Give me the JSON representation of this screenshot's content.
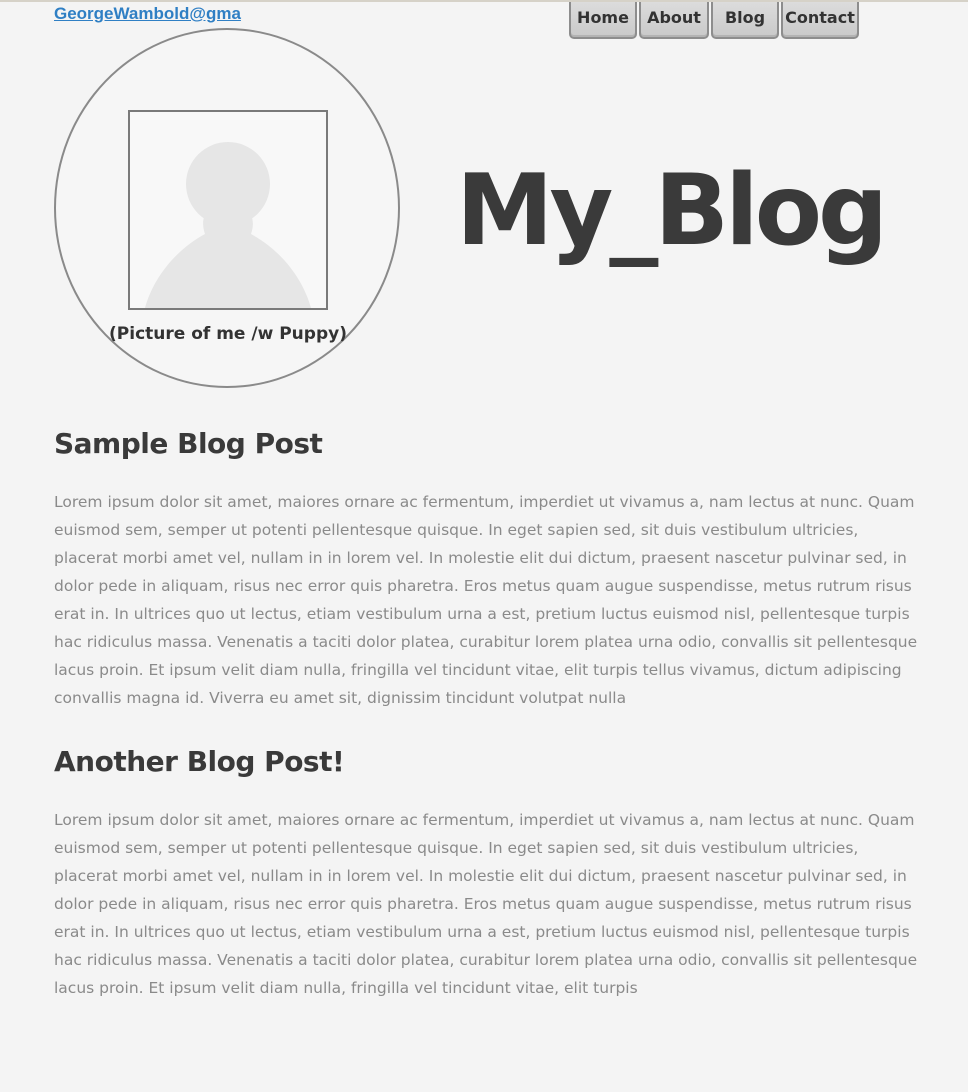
{
  "header": {
    "email": "GeorgeWambold@gma",
    "nav": [
      {
        "label": "Home"
      },
      {
        "label": "About"
      },
      {
        "label": "Blog"
      },
      {
        "label": "Contact"
      }
    ]
  },
  "profile": {
    "caption": "(Picture of me /w Puppy)"
  },
  "site_title": "My_Blog",
  "posts": [
    {
      "title": "Sample Blog Post",
      "body": "Lorem ipsum dolor sit amet, maiores ornare ac fermentum, imperdiet ut vivamus a, nam lectus at nunc. Quam euismod sem, semper ut potenti pellentesque quisque. In eget sapien sed, sit duis vestibulum ultricies, placerat morbi amet vel, nullam in in lorem vel. In molestie elit dui dictum, praesent nascetur pulvinar sed, in dolor pede in aliquam, risus nec error quis pharetra. Eros metus quam augue suspendisse, metus rutrum risus erat in.  In ultrices quo ut lectus, etiam vestibulum urna a est, pretium luctus euismod nisl, pellentesque turpis hac ridiculus massa. Venenatis a taciti dolor platea, curabitur lorem platea urna odio, convallis sit pellentesque lacus proin. Et ipsum velit diam nulla, fringilla vel tincidunt vitae, elit turpis tellus vivamus, dictum adipiscing convallis magna id. Viverra eu amet sit, dignissim tincidunt volutpat nulla"
    },
    {
      "title": "Another Blog Post!",
      "body": "Lorem ipsum dolor sit amet, maiores ornare ac fermentum, imperdiet ut vivamus a, nam lectus at nunc. Quam euismod sem, semper ut potenti pellentesque quisque. In eget sapien sed, sit duis vestibulum ultricies, placerat morbi amet vel, nullam in in lorem vel. In molestie elit dui dictum, praesent nascetur pulvinar sed, in dolor pede in aliquam, risus nec error quis pharetra. Eros metus quam augue suspendisse, metus rutrum risus erat in.  In ultrices quo ut lectus, etiam vestibulum urna a est, pretium luctus euismod nisl, pellentesque turpis hac ridiculus massa. Venenatis a taciti dolor platea, curabitur lorem platea urna odio, convallis sit pellentesque lacus proin. Et ipsum velit diam nulla, fringilla vel tincidunt vitae, elit turpis"
    }
  ],
  "icons": {
    "profile_placeholder": "person-silhouette-icon"
  },
  "colors": {
    "link": "#2f7fc4",
    "heading": "#3a3a3a",
    "body_text": "#8a8a8a",
    "background": "#f4f4f4"
  }
}
